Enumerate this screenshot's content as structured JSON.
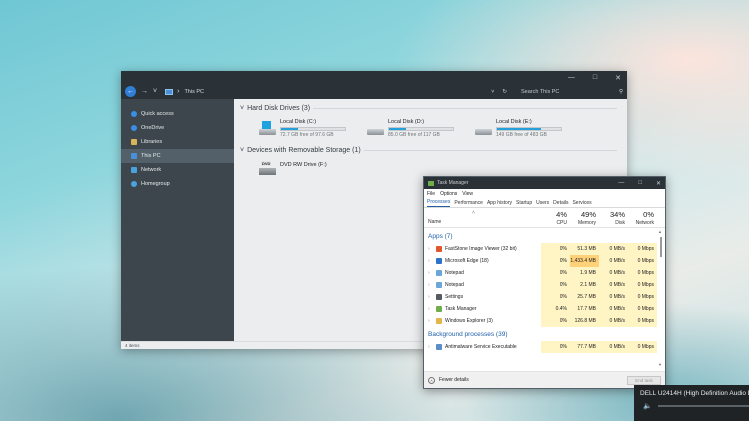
{
  "explorer": {
    "address_path": "This PC",
    "search_placeholder": "Search This PC",
    "sidebar": [
      {
        "label": "Quick access",
        "color": "#3a8ee6"
      },
      {
        "label": "OneDrive",
        "color": "#3a8ee6"
      },
      {
        "label": "Libraries",
        "color": "#d8b45a"
      },
      {
        "label": "This PC",
        "color": "#4a90d9",
        "active": true
      },
      {
        "label": "Network",
        "color": "#4aa3df"
      },
      {
        "label": "Homegroup",
        "color": "#4aa3df"
      }
    ],
    "groups": {
      "hard_disks": "Hard Disk Drives (3)",
      "removable": "Devices with Removable Storage (1)"
    },
    "drives": [
      {
        "name": "Local Disk (C:)",
        "free": "72.7 GB free of 97.6 GB",
        "used_fraction": 0.26,
        "system": true
      },
      {
        "name": "Local Disk (D:)",
        "free": "85.0 GB free of 117 GB",
        "used_fraction": 0.27,
        "system": false
      },
      {
        "name": "Local Disk (E:)",
        "free": "149 GB free of 483 GB",
        "used_fraction": 0.69,
        "system": false
      }
    ],
    "dvd": {
      "name": "DVD RW Drive (F:)",
      "badge": "DVD"
    },
    "status": "4 items"
  },
  "taskmgr": {
    "title": "Task Manager",
    "menu": [
      "File",
      "Options",
      "View"
    ],
    "tabs": [
      "Processes",
      "Performance",
      "App history",
      "Startup",
      "Users",
      "Details",
      "Services"
    ],
    "columns": {
      "name": "Name",
      "cpu": {
        "pct": "4%",
        "label": "CPU"
      },
      "memory": {
        "pct": "49%",
        "label": "Memory"
      },
      "disk": {
        "pct": "34%",
        "label": "Disk"
      },
      "network": {
        "pct": "0%",
        "label": "Network"
      }
    },
    "apps_header": "Apps (7)",
    "apps": [
      {
        "name": "FastStone Image Viewer (32 bit)",
        "cpu": "0%",
        "memory": "51.3 MB",
        "disk": "0 MB/s",
        "network": "0 Mbps",
        "icon": "#e0572f",
        "hot": false
      },
      {
        "name": "Microsoft Edge (18)",
        "cpu": "0%",
        "memory": "1,433.4 MB",
        "disk": "0 MB/s",
        "network": "0 Mbps",
        "icon": "#2f72c9",
        "hot": true
      },
      {
        "name": "Notepad",
        "cpu": "0%",
        "memory": "1.9 MB",
        "disk": "0 MB/s",
        "network": "0 Mbps",
        "icon": "#6aa7d8",
        "hot": false
      },
      {
        "name": "Notepad",
        "cpu": "0%",
        "memory": "2.1 MB",
        "disk": "0 MB/s",
        "network": "0 Mbps",
        "icon": "#6aa7d8",
        "hot": false
      },
      {
        "name": "Settings",
        "cpu": "0%",
        "memory": "25.7 MB",
        "disk": "0 MB/s",
        "network": "0 Mbps",
        "icon": "#555b60",
        "hot": false
      },
      {
        "name": "Task Manager",
        "cpu": "0.4%",
        "memory": "17.7 MB",
        "disk": "0 MB/s",
        "network": "0 Mbps",
        "icon": "#6fae4a",
        "hot": false
      },
      {
        "name": "Windows Explorer (3)",
        "cpu": "0%",
        "memory": "126.8 MB",
        "disk": "0 MB/s",
        "network": "0 Mbps",
        "icon": "#e2b64a",
        "hot": false
      }
    ],
    "bg_header": "Background processes (39)",
    "bg": [
      {
        "name": "Antimalware Service Executable",
        "cpu": "0%",
        "memory": "77.7 MB",
        "disk": "0 MB/s",
        "network": "0 Mbps",
        "icon": "#5b8fc9",
        "hot": false
      }
    ],
    "fewer_details": "Fewer details",
    "end_task": "End task"
  },
  "audio": {
    "device": "DELL U2414H (High Definition Audio D"
  }
}
